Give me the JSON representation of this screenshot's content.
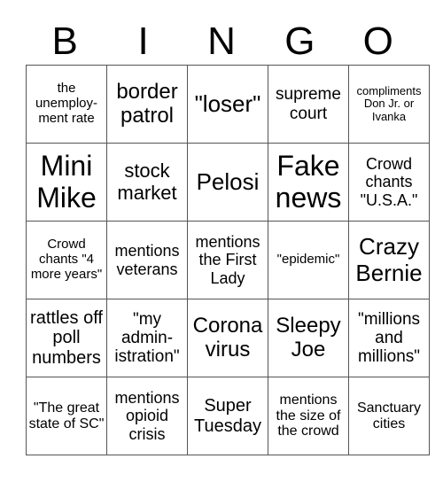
{
  "header": {
    "letters": [
      "B",
      "I",
      "N",
      "G",
      "O"
    ]
  },
  "board": {
    "rows": [
      [
        "the unemploy-ment rate",
        "border patrol",
        "\"loser\"",
        "supreme court",
        "compliments Don Jr. or Ivanka"
      ],
      [
        "Mini Mike",
        "stock market",
        "Pelosi",
        "Fake news",
        "Crowd chants \"U.S.A.\""
      ],
      [
        "Crowd chants \"4 more years\"",
        "mentions veterans",
        "mentions the First Lady",
        "\"epidemic\"",
        "Crazy Bernie"
      ],
      [
        "rattles off poll numbers",
        "\"my admin-istration\"",
        "Corona virus",
        "Sleepy Joe",
        "\"millions and millions\""
      ],
      [
        "\"The great state of SC\"",
        "mentions opioid crisis",
        "Super Tuesday",
        "mentions the size of the crowd",
        "Sanctuary cities"
      ]
    ]
  }
}
